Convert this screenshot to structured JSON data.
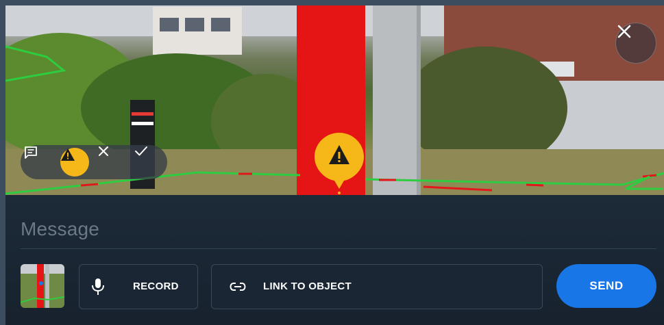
{
  "message": {
    "placeholder": "Message"
  },
  "actions": {
    "record_label": "RECORD",
    "link_label": "LINK TO OBJECT",
    "send_label": "SEND"
  },
  "toolbar": {
    "icons": [
      "comment-icon",
      "warning-icon",
      "close-icon",
      "check-icon"
    ]
  },
  "colors": {
    "accent": "#1976e6",
    "warning": "#f6b818",
    "panel": "#17222e",
    "path_green": "#2ecc40",
    "path_red": "#e3161b"
  }
}
